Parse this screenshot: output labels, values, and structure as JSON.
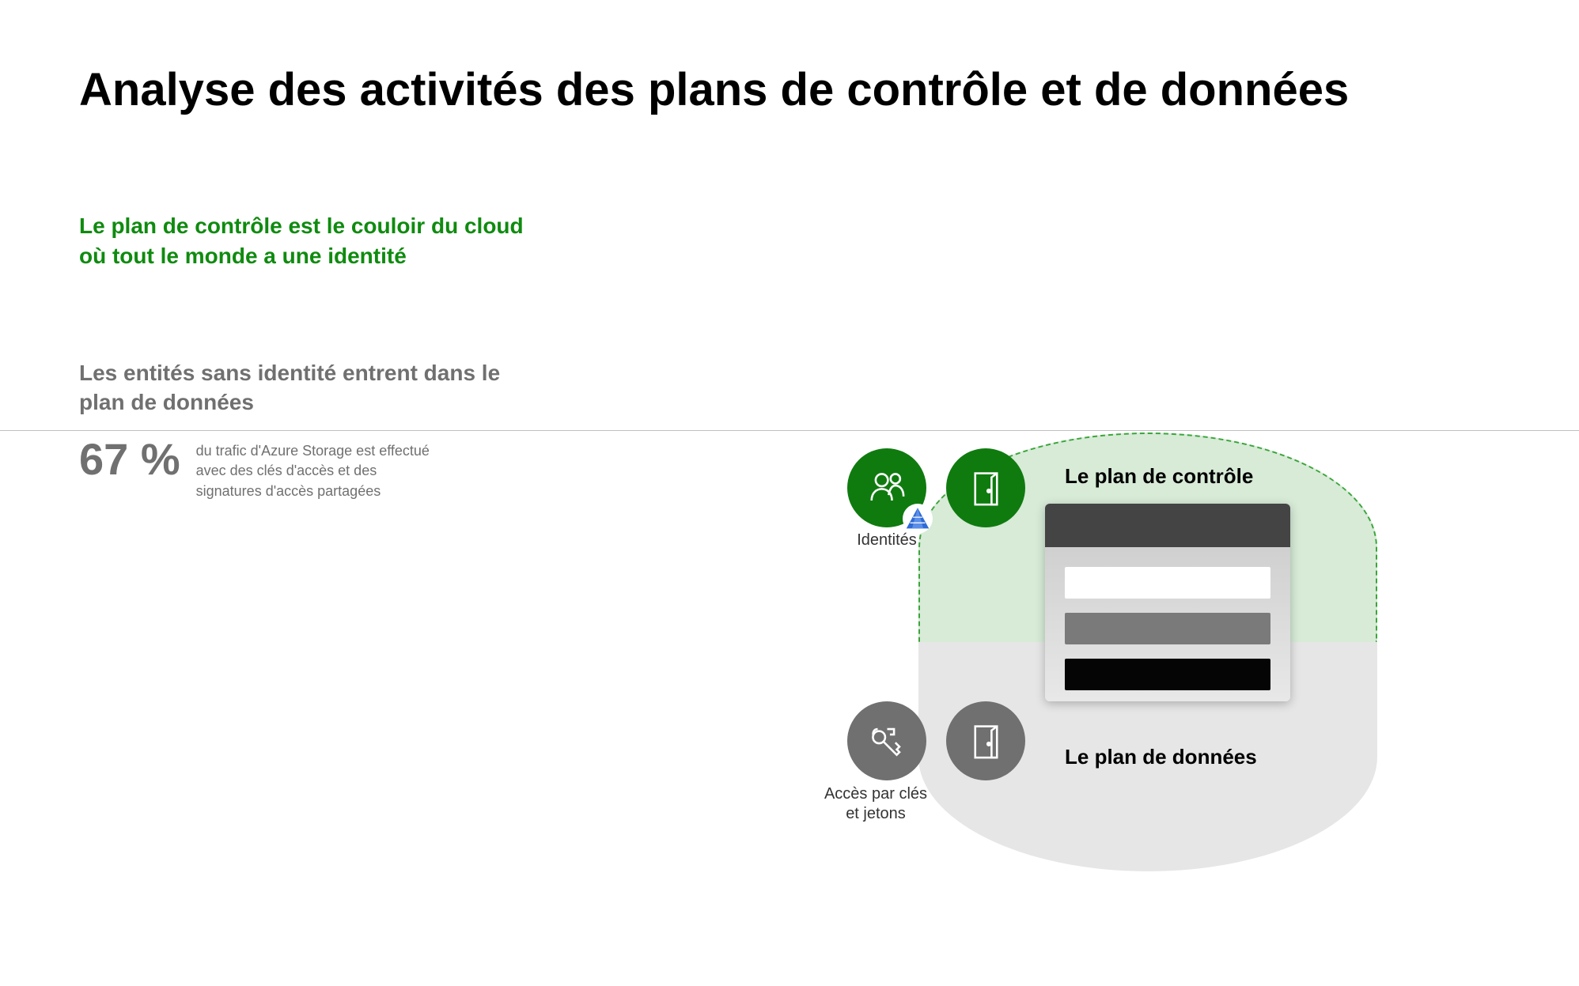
{
  "title": "Analyse des activités des plans de contrôle et de données",
  "left": {
    "control_heading": "Le plan de contrôle est le couloir du cloud où tout le monde a une identité",
    "data_heading": "Les entités sans identité entrent dans le plan de données",
    "stat_value": "67 %",
    "stat_text": "du trafic d'Azure Storage est effectué avec des clés d'accès et des signatures d'accès partagées"
  },
  "diagram": {
    "control_label": "Le plan de contrôle",
    "data_label": "Le plan de données",
    "identities_label": "Identités",
    "keys_label": "Accès par clés et jetons"
  },
  "colors": {
    "accent_green": "#0F8B0F",
    "muted_gray": "#707070"
  }
}
